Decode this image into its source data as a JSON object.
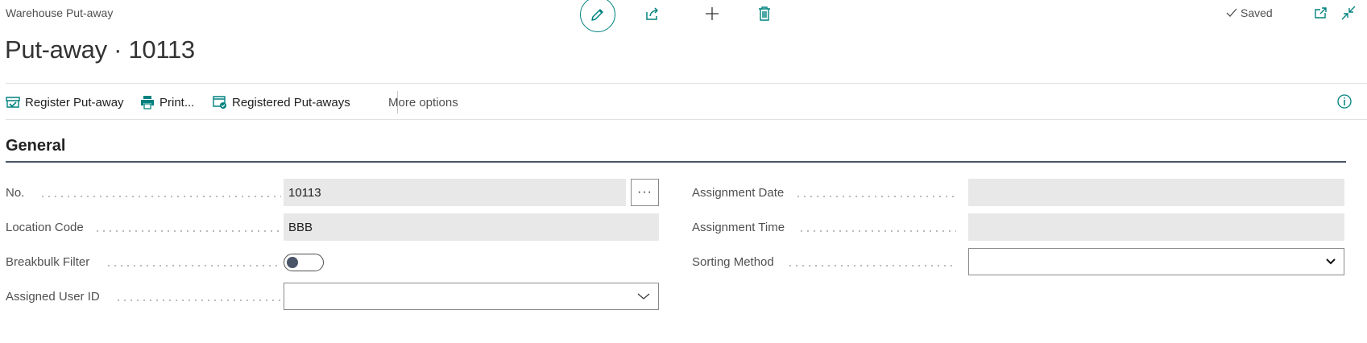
{
  "header": {
    "breadcrumb": "Warehouse Put-away",
    "saved_label": "Saved",
    "title": "Put-away · 10113"
  },
  "icons": {
    "edit": "pencil-icon",
    "share": "share-icon",
    "new": "plus-icon",
    "delete": "trash-icon",
    "open_new_window": "open-in-new-window-icon",
    "collapse": "collapse-icon",
    "info": "info-icon"
  },
  "actionbar": {
    "register": "Register Put-away",
    "print": "Print...",
    "registered": "Registered Put-aways",
    "more": "More options"
  },
  "section": {
    "title": "General"
  },
  "fields": {
    "no": {
      "label": "No.",
      "value": "10113"
    },
    "location_code": {
      "label": "Location Code",
      "value": "BBB"
    },
    "breakbulk_filter": {
      "label": "Breakbulk Filter",
      "value": false
    },
    "assigned_user_id": {
      "label": "Assigned User ID",
      "value": ""
    },
    "assignment_date": {
      "label": "Assignment Date",
      "value": ""
    },
    "assignment_time": {
      "label": "Assignment Time",
      "value": ""
    },
    "sorting_method": {
      "label": "Sorting Method",
      "value": ""
    }
  },
  "colors": {
    "accent": "#00827f",
    "field_bg": "#e8e8e8",
    "section_line": "#4a5568"
  }
}
